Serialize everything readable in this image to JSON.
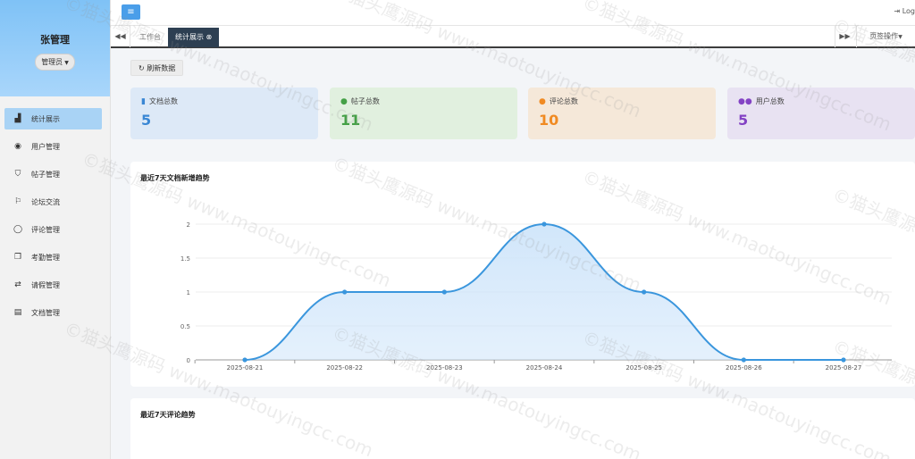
{
  "sidebar": {
    "user_name": "张管理",
    "role_label": "管理员",
    "items": [
      {
        "label": "统计展示",
        "icon": "chart-area-icon",
        "glyph": "▟",
        "active": true
      },
      {
        "label": "用户管理",
        "icon": "user-circle-icon",
        "glyph": "◉",
        "active": false
      },
      {
        "label": "帖子管理",
        "icon": "bookmark-icon",
        "glyph": "⛉",
        "active": false
      },
      {
        "label": "论坛交流",
        "icon": "flag-icon",
        "glyph": "⚐",
        "active": false
      },
      {
        "label": "评论管理",
        "icon": "comment-icon",
        "glyph": "◯",
        "active": false
      },
      {
        "label": "考勤管理",
        "icon": "copy-icon",
        "glyph": "❐",
        "active": false
      },
      {
        "label": "请假管理",
        "icon": "exchange-icon",
        "glyph": "⇄",
        "active": false
      },
      {
        "label": "文档管理",
        "icon": "document-icon",
        "glyph": "▤",
        "active": false
      }
    ]
  },
  "topbar": {
    "menu_icon": "hamburger-icon",
    "logout_label": "Log",
    "logout_icon": "sign-out-icon"
  },
  "tabs": {
    "prev_icon": "double-left-icon",
    "next_icon": "double-right-icon",
    "items": [
      {
        "label": "工作台",
        "active": false
      },
      {
        "label": "统计展示",
        "active": true,
        "closable": true
      }
    ],
    "ops_label": "页签操作"
  },
  "content": {
    "refresh_label": "刷新数据",
    "refresh_icon": "refresh-icon",
    "stats": [
      {
        "label": "文档总数",
        "value": "5",
        "icon": "file-icon",
        "color": "#3a87d4"
      },
      {
        "label": "帖子总数",
        "value": "11",
        "icon": "comments-icon",
        "color": "#44a046"
      },
      {
        "label": "评论总数",
        "value": "10",
        "icon": "comment-icon",
        "color": "#f08a22"
      },
      {
        "label": "用户总数",
        "value": "5",
        "icon": "users-icon",
        "color": "#8342c4"
      }
    ],
    "panel1_title": "最近7天文档新增趋势",
    "panel2_title": "最近7天评论趋势"
  },
  "chart_data": {
    "type": "area",
    "title": "最近7天文档新增趋势",
    "x": [
      "2025-08-21",
      "2025-08-22",
      "2025-08-23",
      "2025-08-24",
      "2025-08-25",
      "2025-08-26",
      "2025-08-27"
    ],
    "series": [
      {
        "values": [
          0,
          1,
          1,
          2,
          1,
          0,
          0
        ]
      }
    ],
    "ylim": [
      0,
      2
    ],
    "yticks": [
      "0",
      "0.5",
      "1",
      "1.5",
      "2"
    ],
    "smooth": true,
    "grid": true,
    "line_color": "#3a96dd",
    "fill_color": "#cfe5fa"
  },
  "watermark": "©猫头鹰源码 www.maotouyingcc.com"
}
